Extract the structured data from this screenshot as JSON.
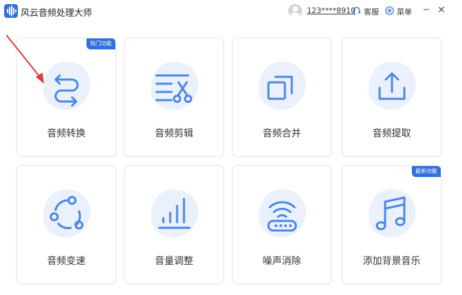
{
  "app": {
    "title": "风云音频处理大师",
    "user_id": "123****8910",
    "service_label": "客服",
    "menu_label": "菜单",
    "minimize_glyph": "−",
    "close_glyph": "✕"
  },
  "colors": {
    "accent": "#2f6fe0",
    "icon_blue": "#4a86e8",
    "blob": "#eaf1fd",
    "arrow": "#e03a3a"
  },
  "cards": [
    {
      "label": "音频转换",
      "icon": "convert-arrows-icon",
      "badge": "热门功能"
    },
    {
      "label": "音频剪辑",
      "icon": "scissors-icon",
      "badge": ""
    },
    {
      "label": "音频合并",
      "icon": "merge-squares-icon",
      "badge": ""
    },
    {
      "label": "音频提取",
      "icon": "upload-tray-icon",
      "badge": ""
    },
    {
      "label": "音频变速",
      "icon": "speed-circle-icon",
      "badge": ""
    },
    {
      "label": "音量调整",
      "icon": "volume-bars-icon",
      "badge": ""
    },
    {
      "label": "噪声消除",
      "icon": "noise-router-icon",
      "badge": ""
    },
    {
      "label": "添加背景音乐",
      "icon": "music-note-icon",
      "badge": "最新功能"
    }
  ]
}
